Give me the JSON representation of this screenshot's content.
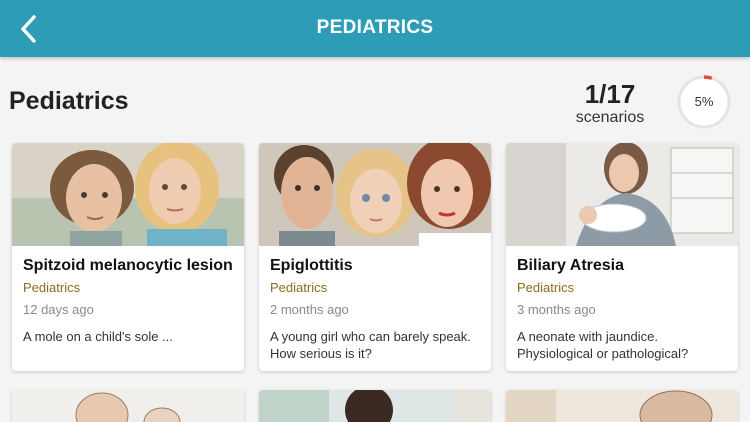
{
  "header": {
    "title": "PEDIATRICS"
  },
  "page": {
    "title": "Pediatrics"
  },
  "progress": {
    "count": "1/17",
    "label": "scenarios",
    "percent_text": "5%",
    "percent_value": 0.05,
    "accent_color": "#e64a3b"
  },
  "cards": [
    {
      "title": "Spitzoid melanocytic lesion",
      "category": "Pediatrics",
      "time": "12 days ago",
      "description": "A mole on a child's sole ..."
    },
    {
      "title": "Epiglottitis",
      "category": "Pediatrics",
      "time": "2 months ago",
      "description": "A young girl who can barely speak. How serious is it?"
    },
    {
      "title": "Biliary Atresia",
      "category": "Pediatrics",
      "time": "3 months ago",
      "description": "A neonate with jaundice. Physiological or pathological?"
    }
  ],
  "colors": {
    "header": "#2d9cb6",
    "category": "#8c6d1f"
  }
}
